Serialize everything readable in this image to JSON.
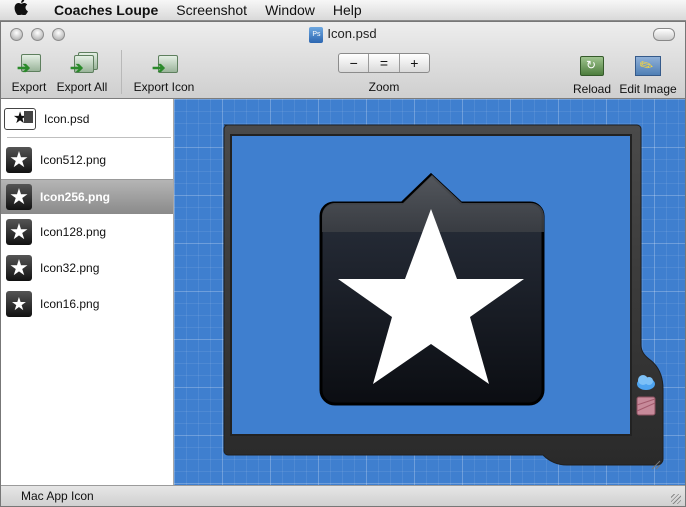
{
  "menubar": {
    "app_name": "Coaches Loupe",
    "menus": [
      "Screenshot",
      "Window",
      "Help"
    ]
  },
  "window": {
    "title": "Icon.psd"
  },
  "toolbar": {
    "export_label": "Export",
    "export_all_label": "Export All",
    "export_icon_label": "Export Icon",
    "zoom_label": "Zoom",
    "zoom_out": "−",
    "zoom_reset": "=",
    "zoom_in": "+",
    "reload_label": "Reload",
    "edit_image_label": "Edit Image"
  },
  "sidebar": {
    "source": "Icon.psd",
    "files": [
      {
        "name": "Icon512.png",
        "selected": false
      },
      {
        "name": "Icon256.png",
        "selected": true
      },
      {
        "name": "Icon128.png",
        "selected": false
      },
      {
        "name": "Icon32.png",
        "selected": false
      },
      {
        "name": "Icon16.png",
        "selected": false
      }
    ]
  },
  "status": {
    "text": "Mac App Icon"
  },
  "icons": {
    "apple": "apple-icon",
    "psd": "psd-file-icon",
    "star": "star-icon",
    "cloud": "cloud-icon",
    "photo": "photo-icon"
  },
  "colors": {
    "canvas_blue": "#3f7fcf",
    "selected_row": "#8a8a8a",
    "frame_dark": "#3a3a3a"
  }
}
